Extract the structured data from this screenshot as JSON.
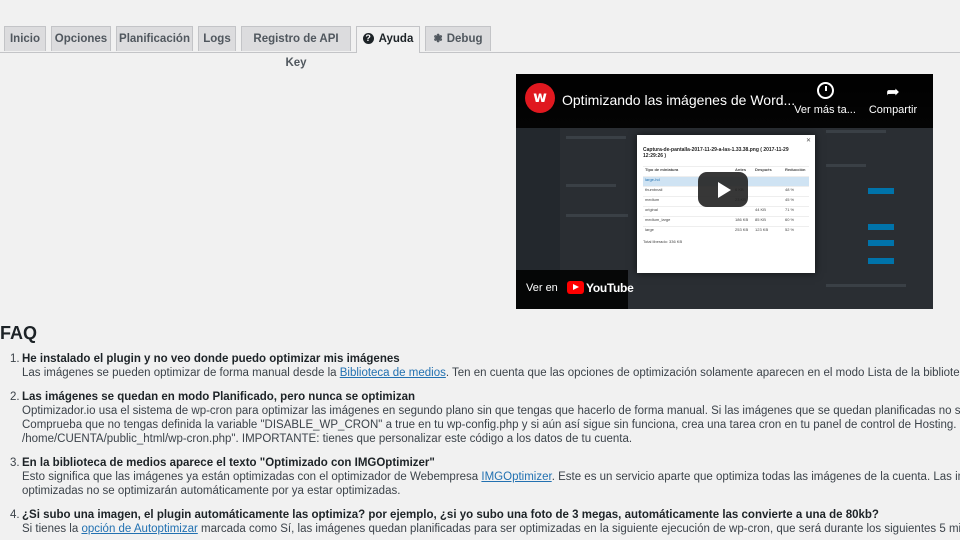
{
  "tabs": [
    {
      "label": "Inicio"
    },
    {
      "label": "Opciones"
    },
    {
      "label": "Planificación"
    },
    {
      "label": "Logs"
    },
    {
      "label": "Registro de API Key"
    },
    {
      "label": "Ayuda",
      "icon": "help-icon",
      "active": true
    },
    {
      "label": "Debug",
      "icon": "debug-icon"
    }
  ],
  "video": {
    "title": "Optimizando las imágenes de Word...",
    "channel_letter": "w",
    "watch_later": "Ver más ta...",
    "share": "Compartir",
    "watch_on": "Ver en",
    "youtube": "YouTube",
    "modal_title": "Captura-de-pantalla-2017-11-29-a-las-1.33.38.png ( 2017-11-29 12:29:26 )",
    "modal_headers": [
      "Tipo de miniatura",
      "Antes",
      "Después",
      "Reducción"
    ],
    "modal_rows": [
      [
        "large-hd",
        "",
        "",
        ""
      ],
      [
        "thumbnail",
        "6 KB",
        "",
        "48 %"
      ],
      [
        "medium",
        "23 KB",
        "",
        "45 %"
      ],
      [
        "original",
        "",
        "44 KB",
        "71 %"
      ],
      [
        "medium_large",
        "186 KB",
        "85 KB",
        "60 %"
      ],
      [
        "large",
        "253 KB",
        "123 KB",
        "52 %"
      ]
    ],
    "modal_footer": "Total liberado: 336 KB",
    "accent": "#e0181f"
  },
  "faq": {
    "title": "FAQ",
    "items": [
      {
        "num": "1.",
        "question": "He instalado el plugin y no veo donde puedo optimizar mis imágenes",
        "lines": [
          {
            "pre": "Las imágenes se pueden optimizar de forma manual desde la ",
            "link": "Biblioteca de medios",
            "post": ". Ten en cuenta que las opciones de optimización solamente aparecen en el modo Lista de la bibliotec"
          }
        ]
      },
      {
        "num": "2.",
        "question": "Las imágenes se quedan en modo Planificado, pero nunca se optimizan",
        "lines": [
          {
            "pre": "Optimizador.io usa el sistema de wp-cron para optimizar las imágenes en segundo plano sin que tengas que hacerlo de forma manual. Si las imágenes que se quedan planificadas no se"
          },
          {
            "pre": "Comprueba que no tengas definida la variable \"DISABLE_WP_CRON\" a true en tu wp-config.php y si aún así sigue sin funciona, crea una tarea cron en tu panel de control de Hosting. La"
          },
          {
            "pre": "/home/CUENTA/public_html/wp-cron.php\". IMPORTANTE: tienes que personalizar este código a los datos de tu cuenta."
          }
        ]
      },
      {
        "num": "3.",
        "question": "En la biblioteca de medios aparece el texto \"Optimizado con IMGOptimizer\"",
        "lines": [
          {
            "pre": "Esto significa que las imágenes ya están optimizadas con el optimizador de Webempresa ",
            "link": "IMGOptimizer",
            "post": ". Este es un servicio aparte que optimiza todas las imágenes de la cuenta. Las im"
          },
          {
            "pre": "optimizadas no se optimizarán automáticamente por ya estar optimizadas."
          }
        ]
      },
      {
        "num": "4.",
        "question": "¿Si subo una imagen, el plugin automáticamente las optimiza? por ejemplo, ¿si yo subo una foto de 3 megas, automáticamente las convierte a una de 80kb?",
        "lines": [
          {
            "pre": "Si tienes la ",
            "link": "opción de Autoptimizar",
            "post": " marcada como Sí, las imágenes quedan planificadas para ser optimizadas en la siguiente ejecución de wp-cron, que será durante los siguientes 5 min"
          }
        ]
      }
    ]
  }
}
